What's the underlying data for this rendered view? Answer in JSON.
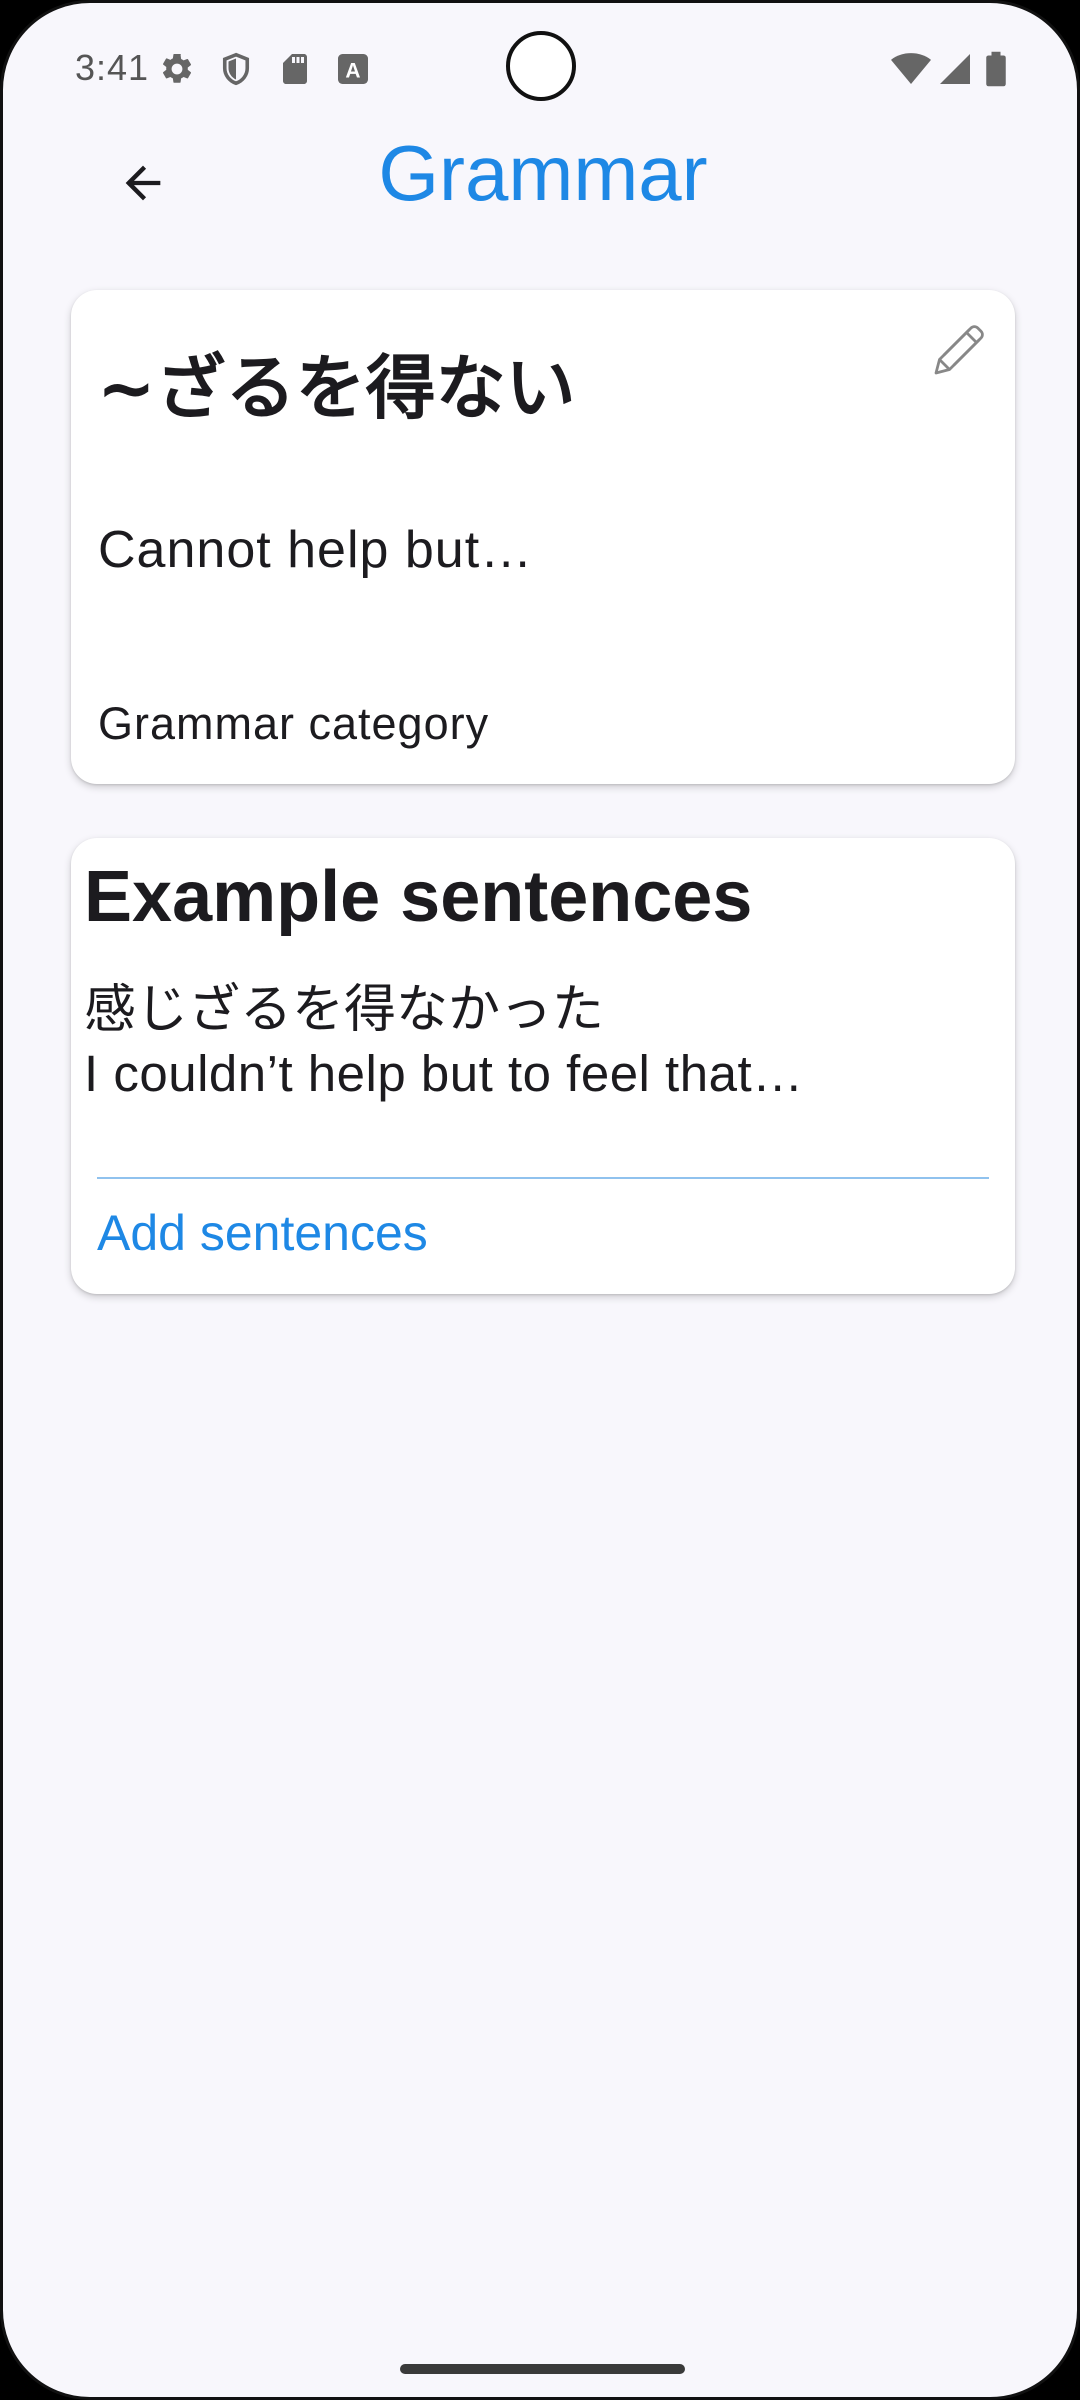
{
  "status_bar": {
    "time": "3:41",
    "left_icons": [
      "gear-icon",
      "shield-icon",
      "sd-card-icon",
      "keyboard-a-icon"
    ],
    "right_icons": [
      "wifi-icon",
      "signal-icon",
      "battery-icon"
    ]
  },
  "app_bar": {
    "title": "Grammar",
    "back_icon": "arrow-left-icon",
    "title_color": "#1E88E5"
  },
  "grammar_card": {
    "pattern": "~ざるを得ない",
    "meaning": "Cannot help but…",
    "category": "Grammar category",
    "edit_icon": "pencil-icon"
  },
  "examples_card": {
    "heading": "Example sentences",
    "examples": [
      {
        "japanese": "感じざるを得なかった",
        "english": "I couldn’t help but to feel that…"
      }
    ],
    "add_label": "Add sentences",
    "accent_color": "#1E88E5"
  }
}
